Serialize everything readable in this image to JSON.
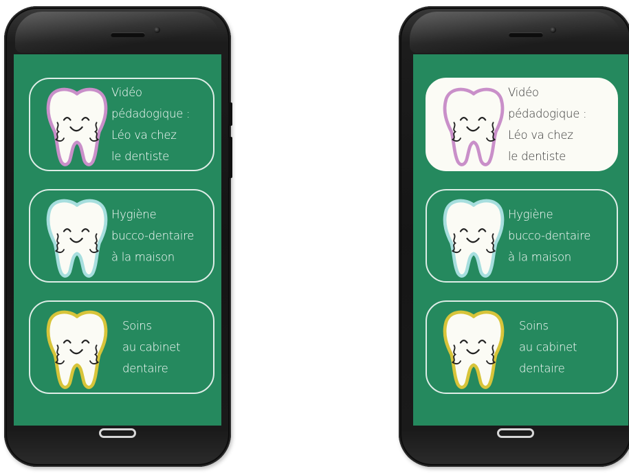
{
  "phones": [
    {
      "variant": "default",
      "menu": [
        {
          "lines": [
            "Vidéo",
            "pédadogique :",
            "Léo va chez",
            "le dentiste"
          ],
          "tooth_outline": "#c98fc9",
          "selected": false
        },
        {
          "lines": [
            "Hygiène",
            "bucco-dentaire",
            "à la maison"
          ],
          "tooth_outline": "#a6dede",
          "selected": false
        },
        {
          "lines": [
            "Soins",
            "au cabinet",
            "dentaire"
          ],
          "tooth_outline": "#d7c43a",
          "selected": false
        }
      ]
    },
    {
      "variant": "first-item-highlighted",
      "menu": [
        {
          "lines": [
            "Vidéo",
            "pédadogique :",
            "Léo va chez",
            "le dentiste"
          ],
          "tooth_outline": "#c98fc9",
          "selected": true
        },
        {
          "lines": [
            "Hygiène",
            "bucco-dentaire",
            "à la maison"
          ],
          "tooth_outline": "#a6dede",
          "selected": false
        },
        {
          "lines": [
            "Soins",
            "au cabinet",
            "dentaire"
          ],
          "tooth_outline": "#d7c43a",
          "selected": false
        }
      ]
    }
  ],
  "colors": {
    "screen_background": "#25895e",
    "card_border": "#ffffff",
    "selected_card_background": "#fbfbf5",
    "label_text": "#ffffff",
    "selected_label_text": "#333333"
  },
  "icons": {
    "menu_item_icon": "smiling-tooth-icon",
    "home_button_icon": "home-button"
  }
}
